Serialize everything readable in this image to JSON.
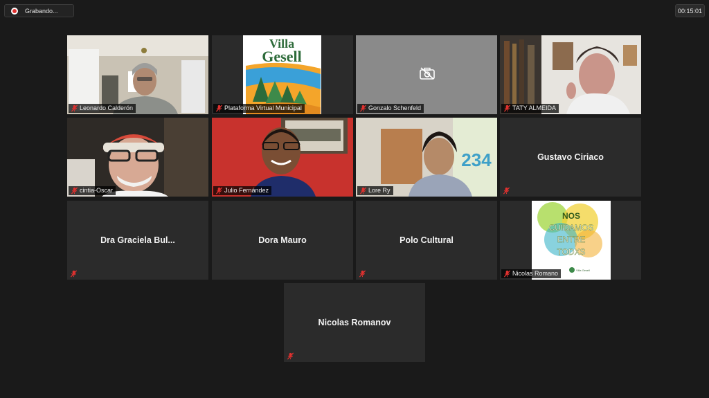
{
  "recording": {
    "label": "Grabando..."
  },
  "meeting": {
    "timer": "00:15:01"
  },
  "participants": [
    {
      "name": "Leonardo Calderón"
    },
    {
      "name": "Plataforma Virtual Municipal",
      "logo_text": "Villa Gesell"
    },
    {
      "name": "Gonzalo Schenfeld"
    },
    {
      "name": "TATY ALMEIDA"
    },
    {
      "name": "cintia-Oscar"
    },
    {
      "name": "Julio Fernández"
    },
    {
      "name": "Lore Ry",
      "wall_text": "234"
    },
    {
      "name": "Gustavo Ciriaco"
    },
    {
      "name": "Dra Graciela Bul..."
    },
    {
      "name": "Dora Mauro"
    },
    {
      "name": "Polo Cultural"
    },
    {
      "name": "Nicolas Romano",
      "logo_text": [
        "NOS",
        "CUIDAMOS",
        "ENTRE",
        "TODXS"
      ],
      "logo_small": "Villa Gesell"
    },
    {
      "name": "Nicolas Romanov"
    }
  ],
  "colors": {
    "active_speaker": "#b9d83a",
    "muted_icon": "#e0312f",
    "tile_bg": "#2b2b2b"
  }
}
